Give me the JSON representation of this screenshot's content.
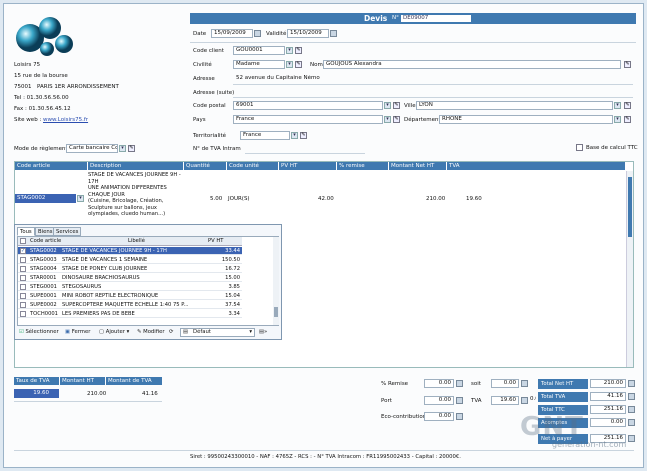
{
  "company": {
    "name": "Loisirs 75",
    "street": "15 rue de la bourse",
    "postcode": "75001",
    "city": "PARIS 1ER ARRONDISSEMENT",
    "tel": "Tel : 01.30.56.56.00",
    "fax": "Fax : 01.30.56.45.12",
    "web_label": "Site web :",
    "web_value": "www.Loisirs75.fr"
  },
  "header": {
    "title": "Devis",
    "number_label": "N°",
    "number_value": "DE09007"
  },
  "form": {
    "date_label": "Date",
    "date_value": "15/09/2009",
    "validite_label": "Validité",
    "validite_value": "15/10/2009",
    "code_client_label": "Code client",
    "code_client_value": "GOU0001",
    "civilite_label": "Civilité",
    "civilite_value": "Madame",
    "nom_label": "Nom",
    "nom_value": "GOUJOUS Alexandra",
    "adresse_label": "Adresse",
    "adresse_value": "52 avenue du Capitaine Némo",
    "adresse_suite_label": "Adresse (suite)",
    "cp_label": "Code postal",
    "cp_value": "69001",
    "ville_label": "Ville",
    "ville_value": "LYON",
    "pays_label": "Pays",
    "pays_value": "France",
    "dept_label": "Département",
    "dept_value": "RHONE",
    "territorialite_label": "Territorialité",
    "territorialite_value": "France",
    "tva_intra_label": "N° de TVA Intram",
    "reglement_label": "Mode de règlement",
    "reglement_value": "Carte bancaire Corr",
    "base_ttc_label": "Base de calcul TTC"
  },
  "table": {
    "columns": [
      "Code article",
      "Description",
      "Quantité",
      "Code unité",
      "PV HT",
      "% remise",
      "Montant Net HT",
      "TVA"
    ],
    "row": {
      "code": "STAG0002",
      "description": "STAGE DE VACANCES JOURNEE 9H - 17H\nUNE ANIMATION DIFFERENTES CHAQUE JOUR\n(Cuisine, Bricolage, Création, Sculpture sur ballons, jeux olympiades, cluedo human...)",
      "qty": "5.00",
      "unit": "JOUR(S)",
      "pvht": "42.00",
      "remise": "",
      "montant": "210.00",
      "tva": "19.60"
    }
  },
  "popup": {
    "tabs": [
      "Tous",
      "Biens",
      "Services"
    ],
    "columns": [
      "Code article",
      "Libellé",
      "PV HT"
    ],
    "rows": [
      {
        "code": "STAG0002",
        "label": "STAGE DE VACANCES JOURNEE 9H - 17H",
        "pv": "33.44"
      },
      {
        "code": "STAG0003",
        "label": "STAGE DE VACANCES 1 SEMAINE",
        "pv": "150.50"
      },
      {
        "code": "STAG0004",
        "label": "STAGE DE PONEY CLUB JOURNEE",
        "pv": "16.72"
      },
      {
        "code": "STAR0001",
        "label": "DINOSAURE BRACHIOSAURUS",
        "pv": "15.00"
      },
      {
        "code": "STEG0001",
        "label": "STEGOSAURUS",
        "pv": "3.85"
      },
      {
        "code": "SUPE0001",
        "label": "MINI ROBOT REPTILE ELECTRONIQUE",
        "pv": "15.04"
      },
      {
        "code": "SUPE0002",
        "label": "SUPERCOPTERE MAQUETTE ECHELLE 1:40 75 P...",
        "pv": "37.54"
      },
      {
        "code": "TOCH0001",
        "label": "LES PREMIERS PAS DE BEBE",
        "pv": "3.34"
      }
    ],
    "toolbar": {
      "select": "Sélectionner",
      "close": "Fermer",
      "add": "Ajouter",
      "edit": "Modifier",
      "filter": "Défaut"
    }
  },
  "tva_summary": {
    "columns": [
      "Taux de TVA",
      "Montant HT",
      "Montant de TVA"
    ],
    "taux": "19.60",
    "ht": "210.00",
    "tva": "41.16"
  },
  "mid": {
    "remise_label": "% Remise",
    "remise_value": "0.00",
    "soit_label": "soit",
    "soit_value": "0.00",
    "port_label": "Port",
    "port_value": "0.00",
    "tva_label": "TVA",
    "tva_value": "19.60",
    "tva2_value": "0.00",
    "eco_label": "Eco-contribution",
    "eco_value": "0.00"
  },
  "totals": {
    "net_ht_label": "Total Net HT",
    "net_ht": "210.00",
    "tva_label": "Total TVA",
    "tva": "41.16",
    "ttc_label": "Total TTC",
    "ttc": "251.16",
    "acompte_label": "Acomptes",
    "acompte": "0.00",
    "net_label": "Net à payer",
    "net": "251.16"
  },
  "footer": {
    "text": "Siret : 99500243300010 - NAF : 4765Z - RCS : - N° TVA Intracom : FR11995002433 - Capital : 20000€."
  },
  "watermark": {
    "text": "generation-nt.com"
  }
}
